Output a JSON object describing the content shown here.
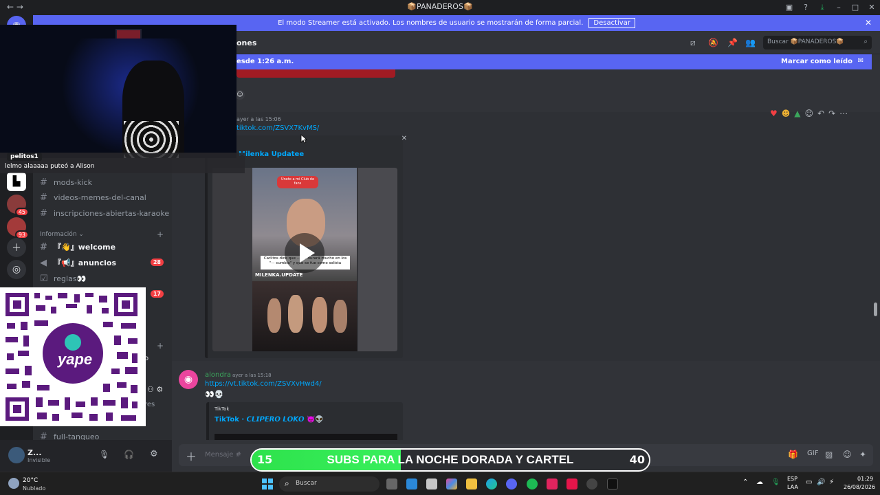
{
  "window": {
    "title": "📦PANADEROS📦"
  },
  "streamer": {
    "text": "El modo Streamer está activado. Los nombres de usuario se mostrarán de forma parcial.",
    "button": "Desactivar"
  },
  "header": {
    "channel_fragment": "ones",
    "search_placeholder": "Buscar 📦PANADEROS📦"
  },
  "new_messages": {
    "left": "esde 1:26 a.m.",
    "mark_read": "Marcar como leído"
  },
  "chat_overlay": {
    "user": "pelitos1",
    "message": "lelmo alaaaaa puteó a Alison"
  },
  "rail": {
    "badge1": "45",
    "badge2": "93"
  },
  "channels": [
    {
      "name": "mods-kick",
      "bold": false
    },
    {
      "name": "videos-memes-del-canal",
      "bold": false
    },
    {
      "name": "inscripciones-abiertas-karaoke",
      "bold": false
    }
  ],
  "category": {
    "label": "Información"
  },
  "info_channels": [
    {
      "name": "『👋』welcome",
      "badge": ""
    },
    {
      "name": "『📢』anuncios",
      "badge": "28"
    },
    {
      "name": "reglas👀",
      "badge": ""
    }
  ],
  "extra_badge": "17",
  "partial_text": {
    "o": "o",
    "res": "res"
  },
  "bottom_channel": "full-tanqueo",
  "user": {
    "name": "Z...",
    "status": "Invisible"
  },
  "message1": {
    "time": "ayer a las 15:06",
    "link": "tiktok.com/ZSVX7KvMS/",
    "embed_provider_fragment": "···",
    "embed_title": "Milenka Updatee",
    "video_top_label": "Únete a mi Club de fans",
    "video_caption": "Carlitos dice que ··· no durará mucho en los \"··· cumbia\" y que se fue como solista",
    "video_watermark": "MILENKA.UPDATE"
  },
  "message2": {
    "author": "alondra",
    "time": "ayer a las 15:18",
    "link": "https://vt.tiktok.com/ZSVXvHwd4/",
    "text": "👀💀",
    "embed_provider": "TikTok",
    "embed_title": "TikTok · 𝘾𝙇𝙄𝙋𝙀𝙍𝙊 𝙇𝙊𝙆𝙊 👿👽"
  },
  "composer": {
    "placeholder": "Mensaje #"
  },
  "subs_goal": {
    "current": "15",
    "label": "SUBS PARA LA NOCHE DORADA Y CARTEL",
    "goal": "40",
    "progress": 0.375
  },
  "taskbar": {
    "weather_temp": "20°C",
    "weather_desc": "Nublado",
    "search": "Buscar",
    "lang1": "ESP",
    "lang2": "LAA",
    "time": "01:29",
    "date": "26/08/2026"
  },
  "qr": {
    "brand": "yape"
  }
}
